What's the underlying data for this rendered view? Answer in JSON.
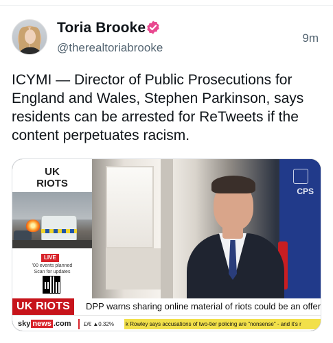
{
  "tweet": {
    "author_name": "Toria Brooke",
    "handle": "@therealtoriabrooke",
    "timestamp": "9m",
    "verified_icon": "verified-badge-icon",
    "text": "ICYMI — Director of Public Prosecutions for England and Wales, Stephen Parkinson, says residents can be arrested for ReTweets if the content perpetuates racism."
  },
  "media": {
    "panel": {
      "title_line1": "UK",
      "title_line2": "RIOTS",
      "live_label": "LIVE",
      "note_line1": "'00 events planned",
      "note_line2": "Scan for updates"
    },
    "headline_tag": "UK RIOTS",
    "headline": "DPP warns sharing online material of riots could be an offence",
    "sign_text": "CPS",
    "ticker": {
      "logo_sky": "sky",
      "logo_news": "news",
      "logo_suffix": ".com",
      "market": "£/€ ▲0.32%",
      "text": "k Rowley says accusations of two-tier policing are \"nonsense\" - and it's r"
    }
  },
  "colors": {
    "accent_red": "#c7141b",
    "ticker_yellow": "#f2e04a",
    "verified_pink": "#e8488f"
  }
}
